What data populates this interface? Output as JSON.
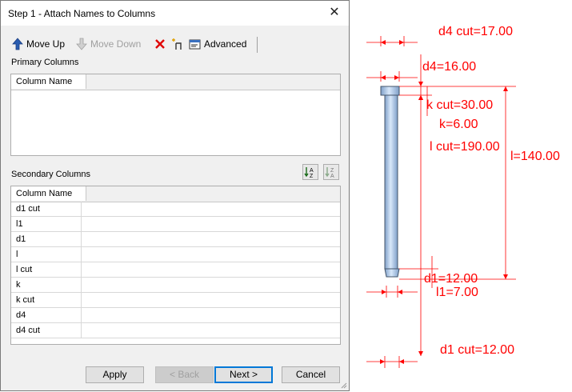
{
  "dialog": {
    "title": "Step 1 - Attach Names to Columns",
    "toolbar": {
      "move_up": "Move Up",
      "move_down": "Move Down",
      "advanced": "Advanced"
    },
    "primary": {
      "label": "Primary Columns",
      "header": "Column Name",
      "rows": []
    },
    "secondary": {
      "label": "Secondary Columns",
      "header": "Column Name",
      "rows": [
        "d1 cut",
        "l1",
        "d1",
        "l",
        "l cut",
        "k",
        "k cut",
        "d4",
        "d4 cut"
      ]
    },
    "buttons": {
      "apply": "Apply",
      "back": "< Back",
      "next": "Next >",
      "cancel": "Cancel"
    }
  },
  "drawing": {
    "labels": {
      "d4_cut": "d4 cut=17.00",
      "d4": "d4=16.00",
      "k_cut": "k cut=30.00",
      "k": "k=6.00",
      "l_cut": "l cut=190.00",
      "l": "l=140.00",
      "d1": "d1=12.00",
      "l1": "l1=7.00",
      "d1_cut": "d1 cut=12.00"
    },
    "colors": {
      "dimension": "#ff0000",
      "pin_body": "#a8c8ec"
    }
  }
}
